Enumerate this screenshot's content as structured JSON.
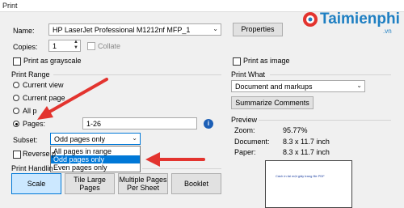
{
  "window": {
    "title": "Print"
  },
  "logo": {
    "brand": "Taimienphi",
    "domain": ".vn"
  },
  "printer": {
    "name_label": "Name:",
    "name_value": "HP LaserJet Professional M1212nf MFP_1",
    "properties_label": "Properties",
    "copies_label": "Copies:",
    "copies_value": "1",
    "collate_label": "Collate",
    "grayscale_label": "Print as grayscale",
    "as_image_label": "Print as image"
  },
  "print_range": {
    "title": "Print Range",
    "current_view": "Current view",
    "current_page": "Current page",
    "all_pages": "All p",
    "pages_label": "Pages:",
    "pages_value": "1-26",
    "subset_label": "Subset:",
    "subset_value": "Odd pages only",
    "subset_options": [
      "All pages in range",
      "Odd pages only",
      "Even pages only"
    ],
    "reverse_label": "Reverse p"
  },
  "print_what": {
    "title": "Print What",
    "value": "Document and markups",
    "summarize_label": "Summarize Comments"
  },
  "preview": {
    "title": "Preview",
    "zoom_label": "Zoom:",
    "zoom_value": "95.77%",
    "document_label": "Document:",
    "document_value": "8.3 x 11.7 inch",
    "paper_label": "Paper:",
    "paper_value": "8.3 x 11.7 inch",
    "page_text": "Cách in tài một giấy trang file PDF"
  },
  "handling": {
    "title": "Print Handlin",
    "scale": "Scale",
    "tile_large_1": "Tile Large",
    "tile_large_2": "Pages",
    "multiple_1": "Multiple Pages",
    "multiple_2": "Per Sheet",
    "booklet": "Booklet"
  },
  "colors": {
    "accent": "#0078d7",
    "annotation": "#e3342f",
    "logo_blue": "#1e7fc2",
    "logo_red": "#e3342f"
  }
}
